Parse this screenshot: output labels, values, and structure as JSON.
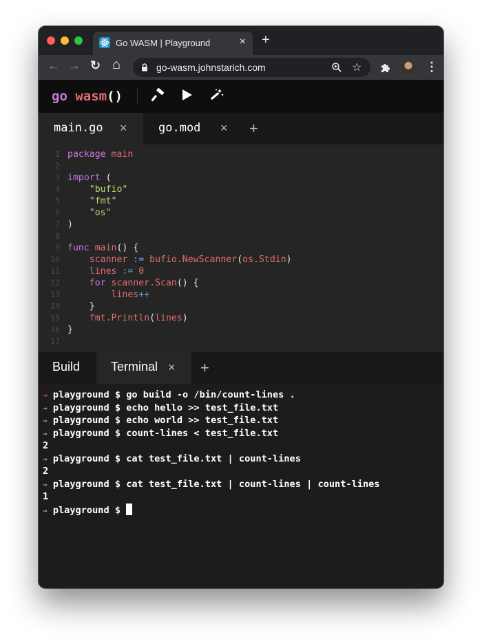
{
  "browser": {
    "tab_title": "Go WASM | Playground",
    "tab_close": "×",
    "new_tab": "+",
    "url": "go-wasm.johnstarich.com",
    "nav": {
      "back": "←",
      "forward": "→",
      "reload": "↻",
      "home": "⌂"
    },
    "star": "☆",
    "menu": "⋮"
  },
  "app": {
    "logo": {
      "go": "go",
      "wasm": "wasm",
      "parens": "()"
    },
    "colors": {
      "keyword": "#c678dd",
      "identifier": "#e06c75",
      "string": "#b5d96e",
      "operator": "#61afef"
    }
  },
  "file_tabs": {
    "items": [
      {
        "label": "main.go",
        "close": "×",
        "active": true
      },
      {
        "label": "go.mod",
        "close": "×",
        "active": false
      }
    ],
    "add": "+"
  },
  "editor": {
    "line_numbers": [
      "1",
      "2",
      "3",
      "4",
      "5",
      "6",
      "7",
      "8",
      "9",
      "10",
      "11",
      "12",
      "13",
      "14",
      "15",
      "16",
      "17"
    ],
    "code": {
      "l1_kw": "package",
      "l1_name": "main",
      "l3_kw": "import",
      "l3_paren": "(",
      "l4_str": "\"bufio\"",
      "l5_str": "\"fmt\"",
      "l6_str": "\"os\"",
      "l7_paren": ")",
      "l9_kw": "func",
      "l9_name": "main",
      "l9_rest": "() {",
      "l10_var": "scanner",
      "l10_op": ":=",
      "l10_call": "bufio.NewScanner",
      "l10_open": "(",
      "l10_arg": "os.Stdin",
      "l10_close": ")",
      "l11_var": "lines",
      "l11_op": ":=",
      "l11_num": "0",
      "l12_kw": "for",
      "l12_call": "scanner.Scan",
      "l12_rest": "() {",
      "l13_var": "lines",
      "l13_op": "++",
      "l14_brace": "}",
      "l15_call": "fmt.Println",
      "l15_open": "(",
      "l15_arg": "lines",
      "l15_close": ")",
      "l16_brace": "}"
    }
  },
  "bottom_tabs": {
    "build": "Build",
    "terminal": "Terminal",
    "terminal_close": "×",
    "add": "+"
  },
  "terminal": {
    "arrow": "→",
    "lines": [
      "playground $ go build -o /bin/count-lines .",
      "playground $ echo hello >> test_file.txt",
      "playground $ echo world >> test_file.txt",
      "playground $ count-lines < test_file.txt",
      "2",
      "playground $ cat test_file.txt | count-lines",
      "2",
      "playground $ cat test_file.txt | count-lines | count-lines",
      "1",
      "playground $ "
    ],
    "colors": {
      "success_arrow": "#5fb84a",
      "error_arrow": "#e04a3a"
    }
  }
}
